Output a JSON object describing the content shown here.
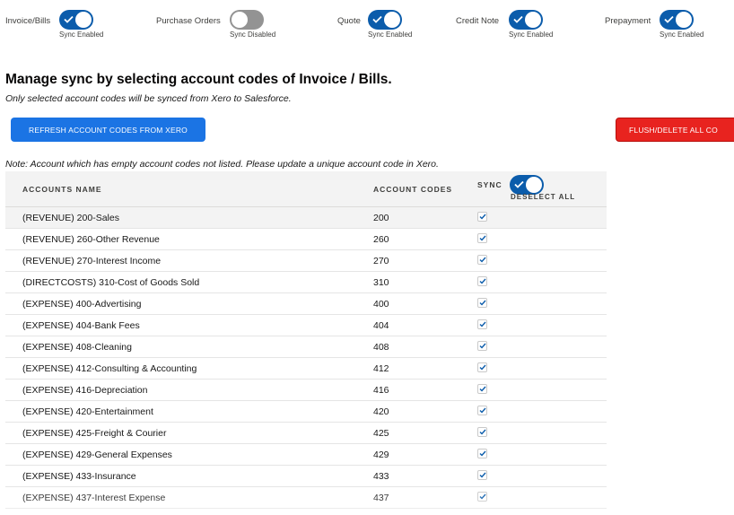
{
  "sync_toggles": [
    {
      "label": "Invoice/Bills",
      "status": "Sync Enabled",
      "enabled": true
    },
    {
      "label": "Purchase Orders",
      "status": "Sync Disabled",
      "enabled": false
    },
    {
      "label": "Quote",
      "status": "Sync Enabled",
      "enabled": true
    },
    {
      "label": "Credit Note",
      "status": "Sync Enabled",
      "enabled": true
    },
    {
      "label": "Prepayment",
      "status": "Sync Enabled",
      "enabled": true
    }
  ],
  "heading": {
    "title": "Manage sync by selecting account codes of Invoice / Bills.",
    "subtitle": "Only selected account codes will be synced from Xero to Salesforce."
  },
  "buttons": {
    "refresh": "REFRESH ACCOUNT CODES FROM XERO",
    "flush": "FLUSH/DELETE ALL CO"
  },
  "note": "Note: Account which has empty account codes not listed. Please update a unique account code in Xero.",
  "table": {
    "columns": {
      "name": "ACCOUNTS NAME",
      "codes": "ACCOUNT CODES",
      "sync": "SYNC",
      "deselect_all": "DESELECT ALL"
    },
    "header_toggle_on": true,
    "rows": [
      {
        "name": "(REVENUE) 200-Sales",
        "code": "200",
        "checked": true
      },
      {
        "name": "(REVENUE) 260-Other Revenue",
        "code": "260",
        "checked": true
      },
      {
        "name": "(REVENUE) 270-Interest Income",
        "code": "270",
        "checked": true
      },
      {
        "name": "(DIRECTCOSTS) 310-Cost of Goods Sold",
        "code": "310",
        "checked": true
      },
      {
        "name": "(EXPENSE) 400-Advertising",
        "code": "400",
        "checked": true
      },
      {
        "name": "(EXPENSE) 404-Bank Fees",
        "code": "404",
        "checked": true
      },
      {
        "name": "(EXPENSE) 408-Cleaning",
        "code": "408",
        "checked": true
      },
      {
        "name": "(EXPENSE) 412-Consulting & Accounting",
        "code": "412",
        "checked": true
      },
      {
        "name": "(EXPENSE) 416-Depreciation",
        "code": "416",
        "checked": true
      },
      {
        "name": "(EXPENSE) 420-Entertainment",
        "code": "420",
        "checked": true
      },
      {
        "name": "(EXPENSE) 425-Freight & Courier",
        "code": "425",
        "checked": true
      },
      {
        "name": "(EXPENSE) 429-General Expenses",
        "code": "429",
        "checked": true
      },
      {
        "name": "(EXPENSE) 433-Insurance",
        "code": "433",
        "checked": true
      },
      {
        "name": "(EXPENSE) 437-Interest Expense",
        "code": "437",
        "checked": true
      }
    ]
  },
  "colors": {
    "toggle_on": "#0b5cab",
    "toggle_off": "#939393",
    "refresh_button": "#1b74e4",
    "flush_button": "#e8231f",
    "checkmark": "#0b5cab"
  }
}
